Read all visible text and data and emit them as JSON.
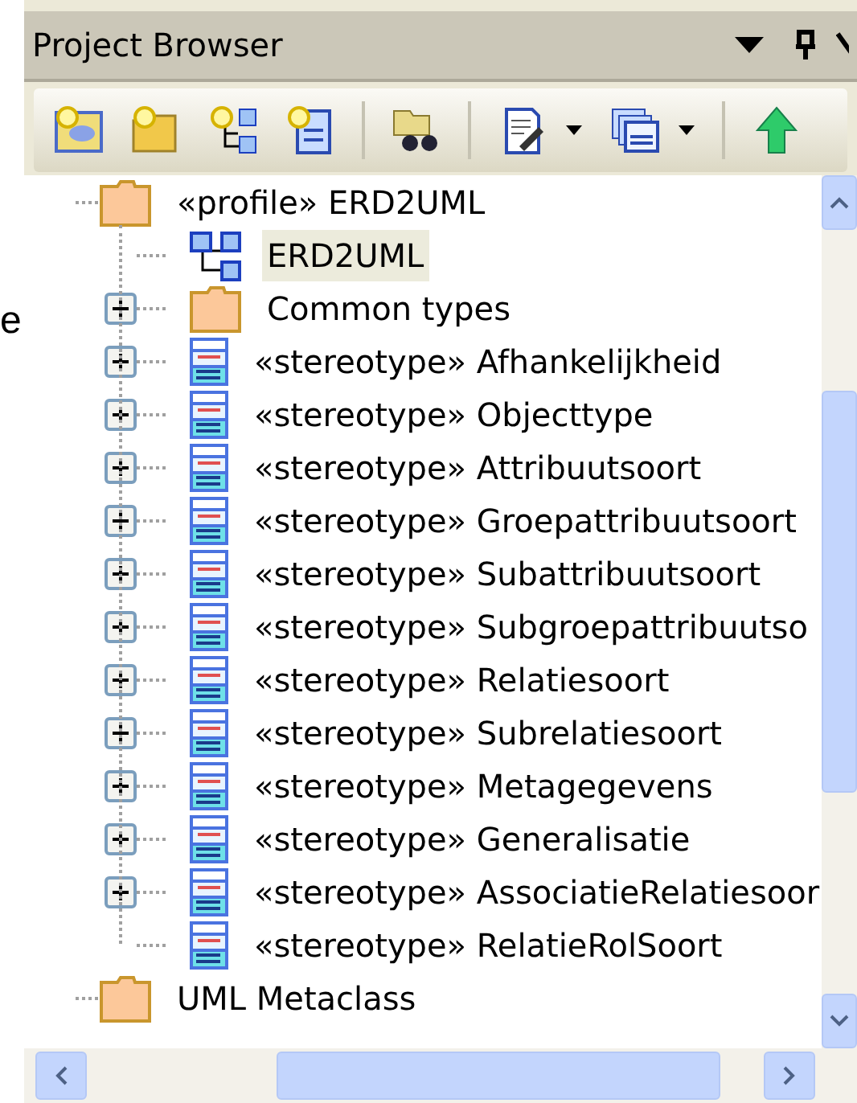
{
  "background_text": "e",
  "panel": {
    "title": "Project Browser"
  },
  "tree": [
    {
      "label": "«profile» ERD2UML",
      "kind": "folder",
      "selected": false,
      "children": [
        {
          "label": "ERD2UML",
          "kind": "diagram",
          "expandable": false,
          "selected": true
        },
        {
          "label": "Common types",
          "kind": "folder",
          "expandable": true,
          "selected": false
        },
        {
          "label": "«stereotype» Afhankelijkheid",
          "kind": "stereotype",
          "expandable": true,
          "selected": false
        },
        {
          "label": "«stereotype» Objecttype",
          "kind": "stereotype",
          "expandable": true,
          "selected": false
        },
        {
          "label": "«stereotype» Attribuutsoort",
          "kind": "stereotype",
          "expandable": true,
          "selected": false
        },
        {
          "label": "«stereotype» Groepattribuutsoort",
          "kind": "stereotype",
          "expandable": true,
          "selected": false
        },
        {
          "label": "«stereotype» Subattribuutsoort",
          "kind": "stereotype",
          "expandable": true,
          "selected": false
        },
        {
          "label": "«stereotype» Subgroepattribuutso",
          "kind": "stereotype",
          "expandable": true,
          "selected": false
        },
        {
          "label": "«stereotype» Relatiesoort",
          "kind": "stereotype",
          "expandable": true,
          "selected": false
        },
        {
          "label": "«stereotype» Subrelatiesoort",
          "kind": "stereotype",
          "expandable": true,
          "selected": false
        },
        {
          "label": "«stereotype» Metagegevens",
          "kind": "stereotype",
          "expandable": true,
          "selected": false
        },
        {
          "label": "«stereotype» Generalisatie",
          "kind": "stereotype",
          "expandable": true,
          "selected": false
        },
        {
          "label": "«stereotype» AssociatieRelatiesoor",
          "kind": "stereotype",
          "expandable": true,
          "selected": false
        },
        {
          "label": "«stereotype» RelatieRolSoort",
          "kind": "stereotype",
          "expandable": false,
          "selected": false
        }
      ]
    },
    {
      "label": "UML Metaclass",
      "kind": "folder",
      "selected": false
    }
  ]
}
